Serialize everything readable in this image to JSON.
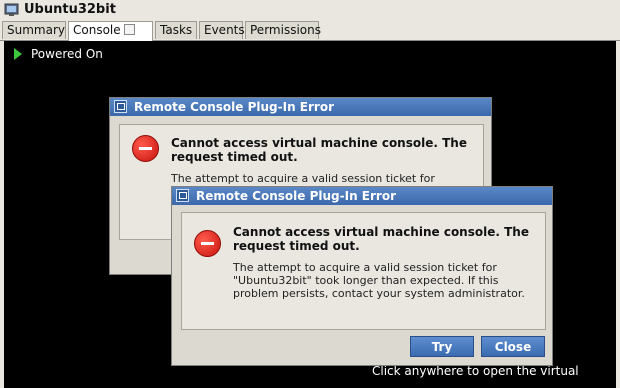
{
  "app": {
    "title": "Ubuntu32bit",
    "icon": "vm-icon"
  },
  "tabs": [
    {
      "label": "Summary",
      "active": false
    },
    {
      "label": "Console",
      "active": true
    },
    {
      "label": "Tasks",
      "active": false
    },
    {
      "label": "Events",
      "active": false
    },
    {
      "label": "Permissions",
      "active": false
    }
  ],
  "console": {
    "status": "Powered On",
    "hint": "Click anywhere to open the virtual"
  },
  "dialog_back": {
    "title": "Remote Console Plug-In Error",
    "heading": "Cannot access virtual machine console. The request timed out.",
    "message": "The attempt to acquire a valid session ticket for \"Ubuntu32bit\" took longer than expected. If this"
  },
  "dialog_front": {
    "title": "Remote Console Plug-In Error",
    "heading": "Cannot access virtual machine console. The request timed out.",
    "message": "The attempt to acquire a valid session ticket for \"Ubuntu32bit\" took longer than expected. If this problem persists, contact your system administrator.",
    "retry_label": "Try",
    "close_label": "Close"
  },
  "colors": {
    "title_blue": "#3a68aa",
    "console_bg": "#000000",
    "error_red": "#d21a12"
  }
}
